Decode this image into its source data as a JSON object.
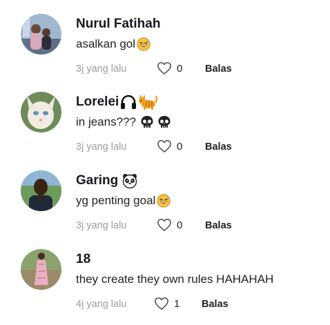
{
  "comments": [
    {
      "username": "Nurul Fatihah",
      "username_emojis": [],
      "text": "asalkan gol",
      "text_emojis": [
        "grinning-sweat-emoji"
      ],
      "time": "3j yang lalu",
      "likes": "0",
      "reply_label": "Balas"
    },
    {
      "username": "Lorelei",
      "username_emojis": [
        "headphones-icon",
        "cat-emoji"
      ],
      "text": "in jeans???",
      "text_emojis": [
        "skull-emoji",
        "skull-emoji"
      ],
      "time": "3j yang lalu",
      "likes": "0",
      "reply_label": "Balas"
    },
    {
      "username": "Garing",
      "username_emojis": [
        "panda-emoji"
      ],
      "text": "yg penting goal",
      "text_emojis": [
        "grinning-sweat-emoji"
      ],
      "time": "3j yang lalu",
      "likes": "0",
      "reply_label": "Balas"
    },
    {
      "username": "18",
      "username_emojis": [],
      "text": "they create they own rules HAHAHAH",
      "text_emojis": [],
      "time": "4j yang lalu",
      "likes": "1",
      "reply_label": "Balas"
    }
  ],
  "colors": {
    "text": "#161823",
    "muted": "#9c9ca3",
    "emoji_yellow": "#f8c43a"
  }
}
